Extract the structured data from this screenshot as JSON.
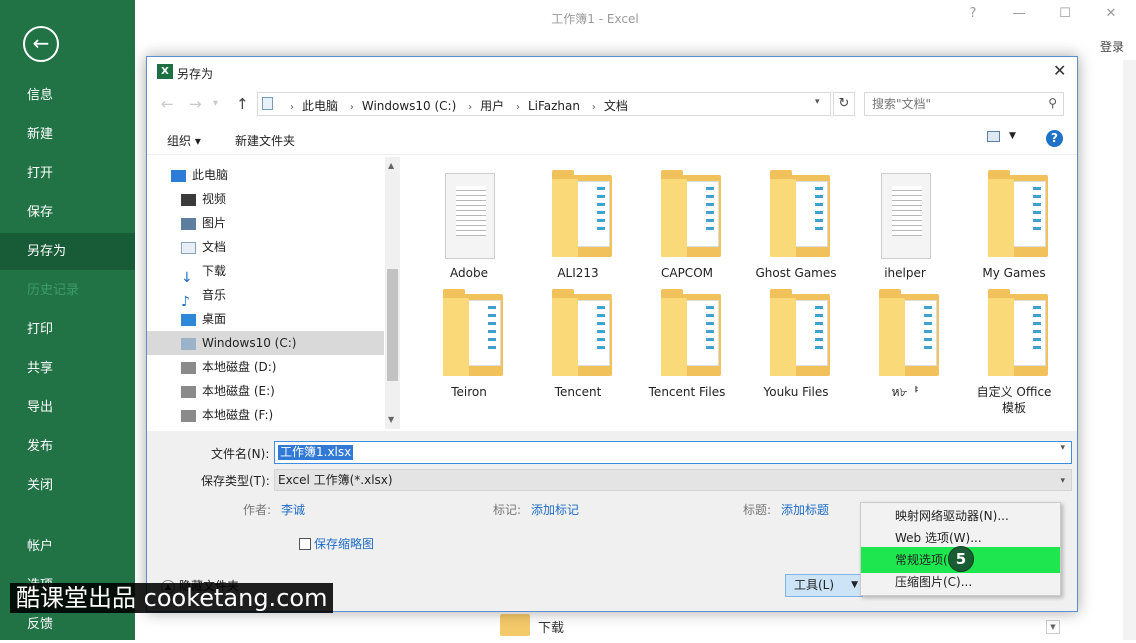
{
  "window": {
    "title": "工作簿1 - Excel",
    "help": "?",
    "minimize": "—",
    "maximize": "☐",
    "close": "✕",
    "login": "登录",
    "bottom_folder_label": "下载"
  },
  "sidebar": {
    "back": "←",
    "items": [
      {
        "label": "信息"
      },
      {
        "label": "新建"
      },
      {
        "label": "打开"
      },
      {
        "label": "保存"
      },
      {
        "label": "另存为"
      },
      {
        "label": "历史记录"
      },
      {
        "label": "打印"
      },
      {
        "label": "共享"
      },
      {
        "label": "导出"
      },
      {
        "label": "发布"
      },
      {
        "label": "关闭"
      },
      {
        "label": "帐户"
      },
      {
        "label": "选项"
      },
      {
        "label": "反馈"
      }
    ]
  },
  "dialog": {
    "title": "另存为",
    "close": "✕",
    "nav": {
      "back": "←",
      "forward": "→",
      "up": "↑",
      "refresh": "↻"
    },
    "breadcrumb": [
      "此电脑",
      "Windows10 (C:)",
      "用户",
      "LiFazhan",
      "文档"
    ],
    "search_placeholder": "搜索\"文档\"",
    "toolbar": {
      "organize": "组织 ▾",
      "new_folder": "新建文件夹",
      "help": "?"
    },
    "tree": [
      {
        "label": "此电脑"
      },
      {
        "label": "视频"
      },
      {
        "label": "图片"
      },
      {
        "label": "文档"
      },
      {
        "label": "下载"
      },
      {
        "label": "音乐"
      },
      {
        "label": "桌面"
      },
      {
        "label": "Windows10 (C:)"
      },
      {
        "label": "本地磁盘 (D:)"
      },
      {
        "label": "本地磁盘 (E:)"
      },
      {
        "label": "本地磁盘 (F:)"
      }
    ],
    "files": [
      {
        "name": "Adobe",
        "kind": "doc"
      },
      {
        "name": "ALI213",
        "kind": "folder"
      },
      {
        "name": "CAPCOM",
        "kind": "folder"
      },
      {
        "name": "Ghost Games",
        "kind": "folder"
      },
      {
        "name": "ihelper",
        "kind": "doc"
      },
      {
        "name": "My Games",
        "kind": "folder"
      },
      {
        "name": "Teiron",
        "kind": "folder"
      },
      {
        "name": "Tencent",
        "kind": "folder"
      },
      {
        "name": "Tencent Files",
        "kind": "folder"
      },
      {
        "name": "Youku Files",
        "kind": "folder"
      },
      {
        "name": "ห৮ᅣ",
        "kind": "folder"
      },
      {
        "name": "自定义 Office 模板",
        "kind": "folder"
      }
    ],
    "form": {
      "filename_label": "文件名(N):",
      "filename_value": "工作簿1.xlsx",
      "savetype_label": "保存类型(T):",
      "savetype_value": "Excel 工作簿(*.xlsx)",
      "author_label": "作者:",
      "author_value": "李诚",
      "tags_label": "标记:",
      "tags_value": "添加标记",
      "title_label": "标题:",
      "title_value": "添加标题",
      "thumbnail_label": "保存缩略图",
      "hide_folders": "隐藏文件夹",
      "tools_button": "工具(L)"
    }
  },
  "tools_menu": {
    "items": [
      {
        "label": "映射网络驱动器(N)..."
      },
      {
        "label": "Web 选项(W)..."
      },
      {
        "label": "常规选项(G)..."
      },
      {
        "label": "压缩图片(C)..."
      }
    ],
    "highlight_color": "#1ee64e",
    "step_badge": "5"
  },
  "watermark": "酷课堂出品 cooketang.com",
  "colors": {
    "excel_green": "#217346",
    "link_blue": "#1e6cc4",
    "folder_yellow": "#f1c15c"
  }
}
